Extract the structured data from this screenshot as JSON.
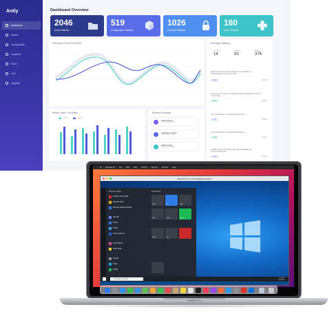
{
  "dashboard": {
    "brand": "Antiy",
    "title": "Dashboard Overview",
    "sidebar": [
      {
        "label": "Dashboard"
      },
      {
        "label": "Assets"
      },
      {
        "label": "Configuration"
      },
      {
        "label": "Loophole"
      },
      {
        "label": "Patch"
      },
      {
        "label": "Tool"
      },
      {
        "label": "Upgrade"
      }
    ],
    "cards": [
      {
        "value": "2046",
        "label": "Asset Statistics",
        "color": "#2e3a8c"
      },
      {
        "value": "519",
        "label": "Configuration Statistics",
        "color": "#5a6de8"
      },
      {
        "value": "1026",
        "label": "Loophole Statistics",
        "color": "#4f8ff0"
      },
      {
        "value": "180",
        "label": "Patch Statistics",
        "color": "#3ec3c8"
      }
    ],
    "trend_title": "Risk Asset Trend This Week",
    "bars_title": "Newly Online This Week",
    "bars_legend": [
      "Lorem",
      "Ipsum"
    ],
    "groups_title": "Terminal Grouping",
    "groups": [
      {
        "name": "Asset Group",
        "sub": "Lorem ipsum dolor"
      },
      {
        "name": "Inspection Group",
        "sub": "Lorem ipsum dolor"
      },
      {
        "name": "Patch Group",
        "sub": "Lorem ipsum dolor"
      }
    ],
    "stats_title": "Coverage Statistics",
    "stats_heads": [
      "Lorem",
      "Ipsum",
      "Dolor"
    ],
    "stats_values": [
      "14",
      "93",
      "376"
    ],
    "insights": [
      {
        "text": "Recommend assets that a high-risk vulnerability are recommended to fix them in time.",
        "tag": "Fixed",
        "tag_color": "#7a5cf0"
      },
      {
        "text": "The host is not secure. It includes updates configuration for the current host.",
        "tag": "Update",
        "tag_color": "#3bb77e"
      },
      {
        "text": "The vulnerability is not fixed within 30 days.",
        "tag": "Open",
        "tag_color": "#4f8ff0"
      },
      {
        "text": "The vulnerability is not fixed within 60 days.",
        "tag": "Update",
        "tag_color": "#3bb77e"
      },
      {
        "text": "Unsafe asset assets that a high-risk vulnerability are recommended to fix.",
        "tag": "Fixed",
        "tag_color": "#7a5cf0"
      }
    ],
    "details_link": "Details >"
  },
  "laptop": {
    "mac_menu": [
      "Windows 10",
      "File",
      "Edit",
      "View",
      "Actions",
      "Devices",
      "Window",
      "Help"
    ],
    "window_title": "Windows 10 on M1 Parallels Desktop",
    "start_menu": {
      "header_left": "Recently added",
      "header_right": "Productivity",
      "apps": [
        "Parallels Tools (ARM)",
        "Windows Tools",
        "Windows Update Assistant",
        "Paint 3D",
        "People",
        "Photos",
        "Power Automate",
        "Snip & Sketch",
        "Sticky Notes",
        "Settings",
        "Skype",
        "Spotify"
      ],
      "tiles": [
        "Office",
        "Mail",
        "Edge",
        "Store",
        "Photos",
        "Spotify",
        "Netflix",
        "Play"
      ]
    },
    "search_placeholder": "Type here to search",
    "tray_time": "3:57 PM",
    "tray_date": "4/12/2021",
    "model_label": "MacBook Pro"
  }
}
